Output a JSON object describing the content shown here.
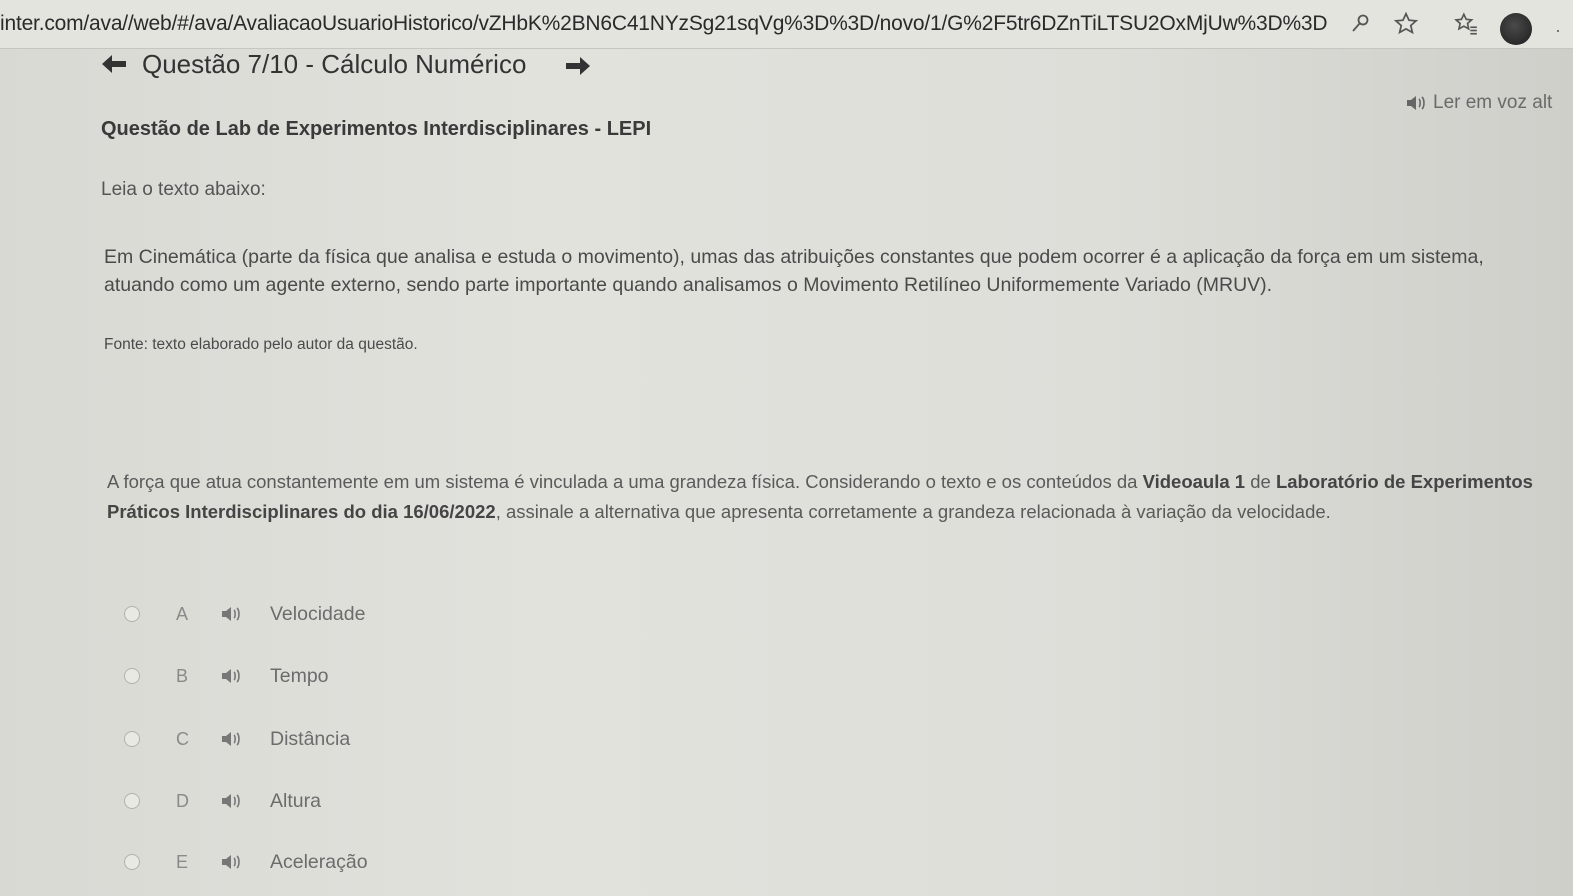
{
  "browser": {
    "url": "inter.com/ava//web/#/ava/AvaliacaoUsuarioHistorico/vZHbK%2BN6C41NYzSg21sqVg%3D%3D/novo/1/G%2F5tr6DZnTiLTSU2OxMjUw%3D%3D"
  },
  "header": {
    "title": "Questão 7/10 - Cálculo Numérico",
    "read_aloud": "Ler em voz alt"
  },
  "content": {
    "subtitle": "Questão de Lab de Experimentos Interdisciplinares - LEPI",
    "intro": "Leia o texto abaixo:",
    "paragraph": "Em Cinemática (parte da física que analisa e estuda o movimento), umas das atribuições constantes que podem ocorrer é a aplicação da força em um sistema, atuando como um agente externo, sendo parte importante quando analisamos o Movimento Retilíneo Uniformemente Variado (MRUV).",
    "source": "Fonte: texto elaborado pelo autor da questão.",
    "question": {
      "part1": "A força que atua constantemente em um sistema é vinculada a uma grandeza física. Considerando o texto e os conteúdos da ",
      "bold1": "Videoaula 1",
      "part2": " de ",
      "bold2": "Laboratório de Experimentos Práticos Interdisciplinares do dia 16/06/2022",
      "part3": ", assinale a alternativa que apresenta corretamente a grandeza relacionada à variação da velocidade."
    }
  },
  "options": [
    {
      "letter": "A",
      "text": "Velocidade"
    },
    {
      "letter": "B",
      "text": "Tempo"
    },
    {
      "letter": "C",
      "text": "Distância"
    },
    {
      "letter": "D",
      "text": "Altura"
    },
    {
      "letter": "E",
      "text": "Aceleração"
    }
  ],
  "icons": {
    "back": "arrow-left-icon",
    "forward": "arrow-right-icon",
    "speaker": "speaker-icon"
  }
}
